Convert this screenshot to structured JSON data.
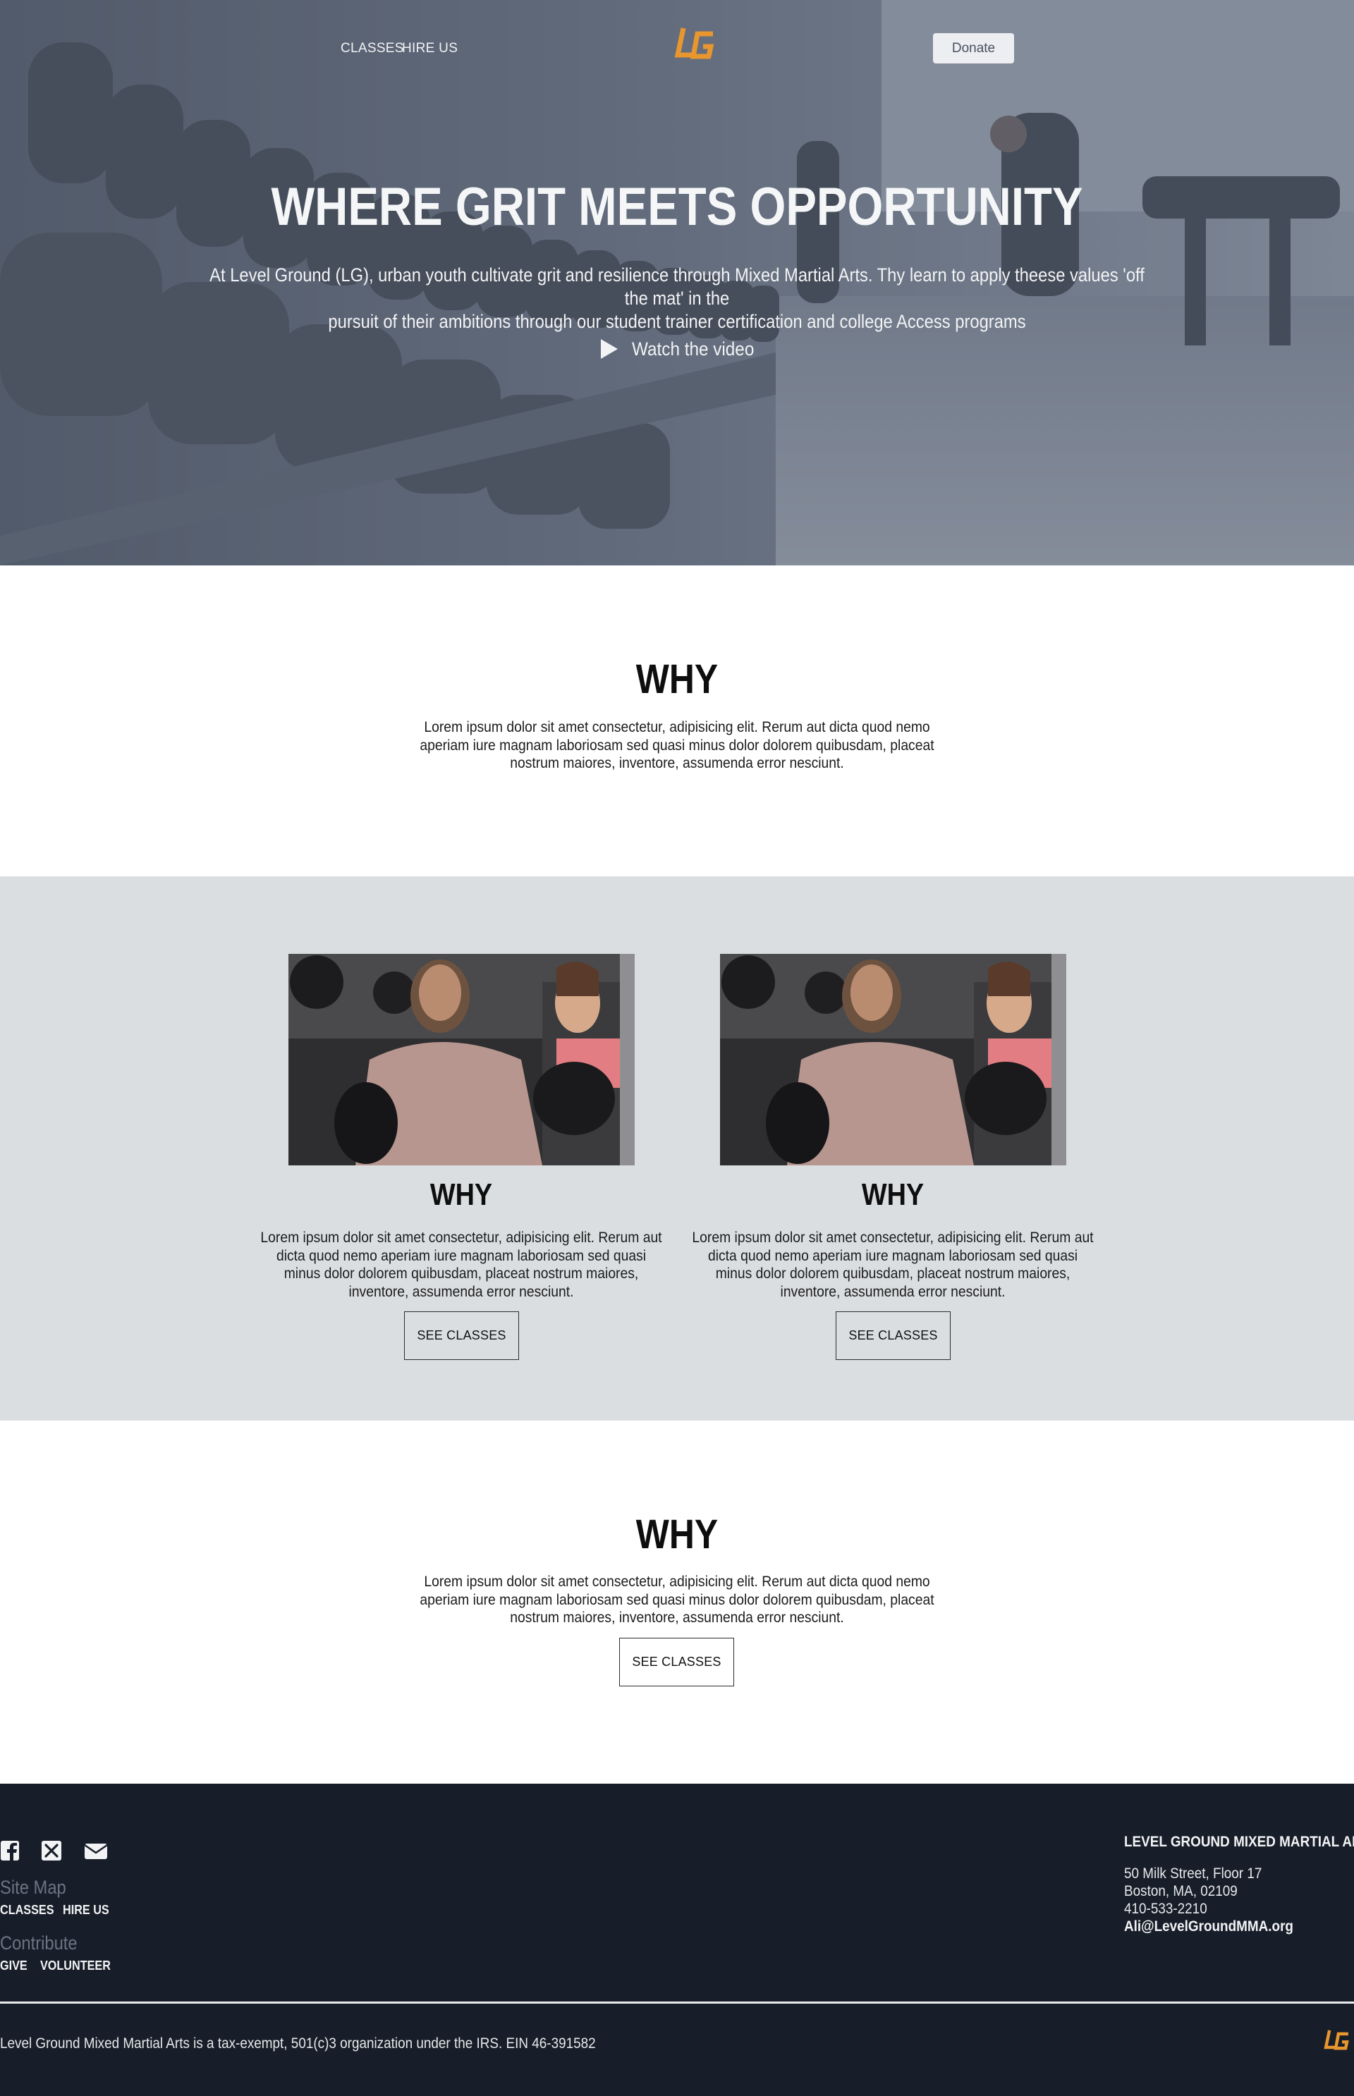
{
  "nav": {
    "links": [
      "CLASSES",
      "HIRE US"
    ],
    "donate_label": "Donate"
  },
  "hero": {
    "title": "WHERE GRIT MEETS OPPORTUNITY",
    "description_line1": "At Level Ground (LG), urban youth cultivate grit and resilience through Mixed Martial Arts. Thy learn to apply theese values 'off the mat' in the",
    "description_line2": "pursuit of their ambitions through our student trainer certification and college Access programs",
    "watch_label": "Watch the video"
  },
  "section_why": {
    "title": "WHY",
    "text": "Lorem ipsum dolor sit amet consectetur, adipisicing elit. Rerum aut dicta quod nemo aperiam iure magnam laboriosam sed quasi minus dolor dolorem quibusdam, placeat nostrum maiores, inventore, assumenda error nesciunt."
  },
  "cards": [
    {
      "title": "WHY",
      "text": "Lorem ipsum dolor sit amet consectetur, adipisicing elit. Rerum aut dicta quod nemo aperiam iure magnam laboriosam sed quasi minus dolor dolorem quibusdam, placeat nostrum maiores, inventore, assumenda error nesciunt.",
      "button": "SEE CLASSES"
    },
    {
      "title": "WHY",
      "text": "Lorem ipsum dolor sit amet consectetur, adipisicing elit. Rerum aut dicta quod nemo aperiam iure magnam laboriosam sed quasi minus dolor dolorem quibusdam, placeat nostrum maiores, inventore, assumenda error nesciunt.",
      "button": "SEE CLASSES"
    }
  ],
  "section_why_2": {
    "title": "WHY",
    "text": "Lorem ipsum dolor sit amet consectetur, adipisicing elit. Rerum aut dicta quod nemo aperiam iure magnam laboriosam sed quasi minus dolor dolorem quibusdam, placeat nostrum maiores, inventore, assumenda error nesciunt.",
    "button": "SEE CLASSES"
  },
  "footer": {
    "social_icons": [
      "facebook-icon",
      "x-icon",
      "email-icon"
    ],
    "site_map_heading": "Site Map",
    "site_map_links": [
      "CLASSES",
      "HIRE US"
    ],
    "contribute_heading": "Contribute",
    "contribute_links": [
      "GIVE",
      "VOLUNTEER"
    ],
    "org_name": "LEVEL GROUND MIXED MARTIAL ARTS",
    "address_line1": "50 Milk Street, Floor 17",
    "address_line2": "Boston, MA, 02109",
    "phone": "410-533-2210",
    "email": "Ali@LevelGroundMMA.org",
    "legal": "Level Ground Mixed Martial Arts is a tax-exempt, 501(c)3 organization under the IRS. EIN 46-391582"
  },
  "colors": {
    "brand_orange": "#e8962e",
    "footer_bg": "#181e29",
    "band_bg": "#dbdee1",
    "hero_overlay": "#5a6476"
  }
}
